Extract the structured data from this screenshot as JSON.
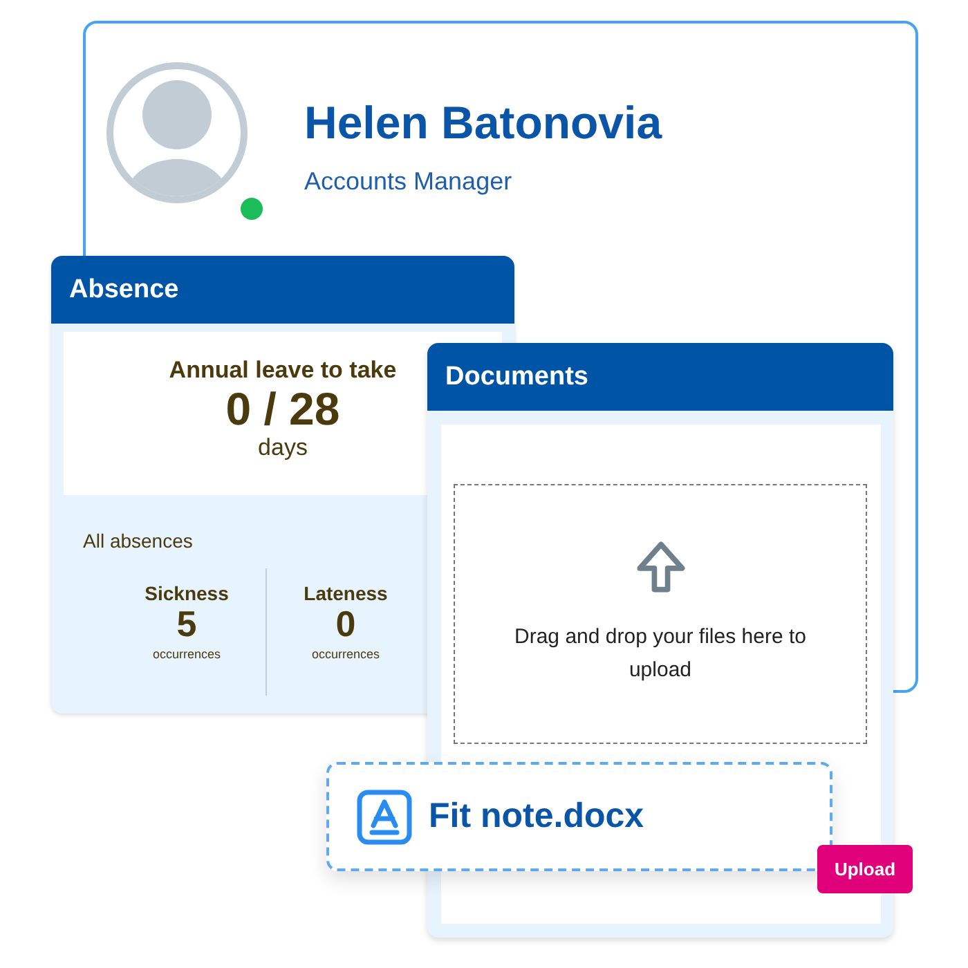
{
  "profile": {
    "name": "Helen Batonovia",
    "title": "Accounts Manager",
    "online": true
  },
  "absence": {
    "title": "Absence",
    "annual_leave": {
      "label": "Annual leave to take",
      "value": "0 / 28",
      "unit": "days"
    },
    "all_label": "All absences",
    "stats": [
      {
        "label": "Sickness",
        "value": "5",
        "unit": "occurrences"
      },
      {
        "label": "Lateness",
        "value": "0",
        "unit": "occurrences"
      }
    ]
  },
  "documents": {
    "title": "Documents",
    "dropzone_text": "Drag and drop your files here to upload",
    "file": {
      "name": "Fit note.docx"
    },
    "upload_button": "Upload"
  }
}
